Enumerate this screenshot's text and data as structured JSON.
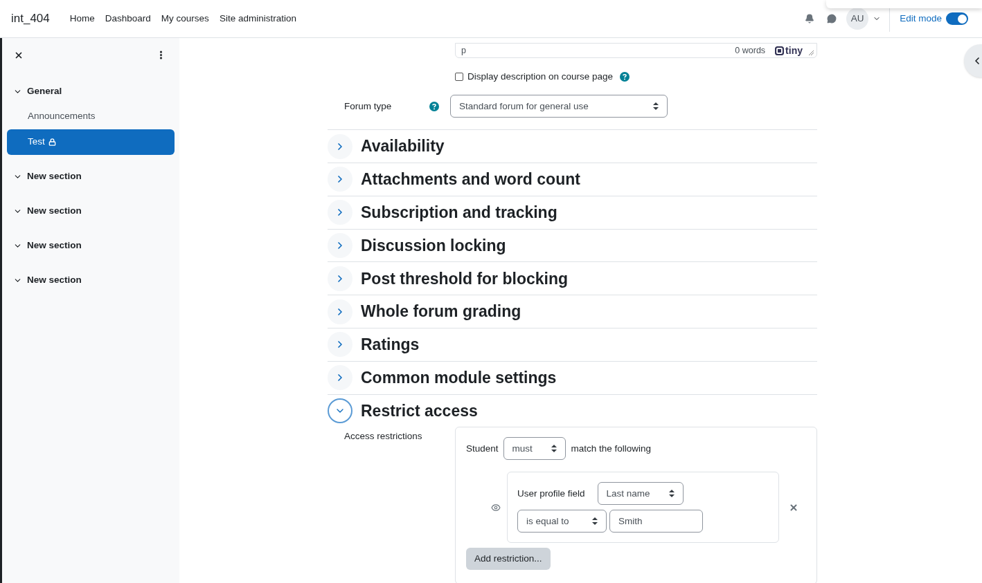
{
  "navbar": {
    "site_name": "int_404",
    "links": [
      "Home",
      "Dashboard",
      "My courses",
      "Site administration"
    ],
    "user_initials": "AU",
    "edit_mode": {
      "label": "Edit mode",
      "on": true
    }
  },
  "sidebar": {
    "sections": [
      {
        "title": "General",
        "expanded": true,
        "children": [
          {
            "label": "Announcements",
            "selected": false,
            "locked": false
          },
          {
            "label": "Test",
            "selected": true,
            "locked": true
          }
        ]
      },
      {
        "title": "New section",
        "expanded": true
      },
      {
        "title": "New section",
        "expanded": true
      },
      {
        "title": "New section",
        "expanded": true
      },
      {
        "title": "New section",
        "expanded": true
      }
    ]
  },
  "editor_footer": {
    "path": "p",
    "word_count": "0 words",
    "logo": "tiny"
  },
  "display_description": {
    "label": "Display description on course page",
    "checked": false
  },
  "forum_type": {
    "label": "Forum type",
    "value": "Standard forum for general use"
  },
  "sections": [
    {
      "title": "Availability",
      "expanded": false
    },
    {
      "title": "Attachments and word count",
      "expanded": false
    },
    {
      "title": "Subscription and tracking",
      "expanded": false
    },
    {
      "title": "Discussion locking",
      "expanded": false
    },
    {
      "title": "Post threshold for blocking",
      "expanded": false
    },
    {
      "title": "Whole forum grading",
      "expanded": false
    },
    {
      "title": "Ratings",
      "expanded": false
    },
    {
      "title": "Common module settings",
      "expanded": false
    },
    {
      "title": "Restrict access",
      "expanded": true
    }
  ],
  "restrict_access": {
    "label": "Access restrictions",
    "prefix": "Student",
    "match": "must",
    "suffix": "match the following",
    "condition": {
      "label": "User profile field",
      "field": "Last name",
      "operator": "is equal to",
      "value": "Smith"
    },
    "add_button": "Add restriction..."
  }
}
